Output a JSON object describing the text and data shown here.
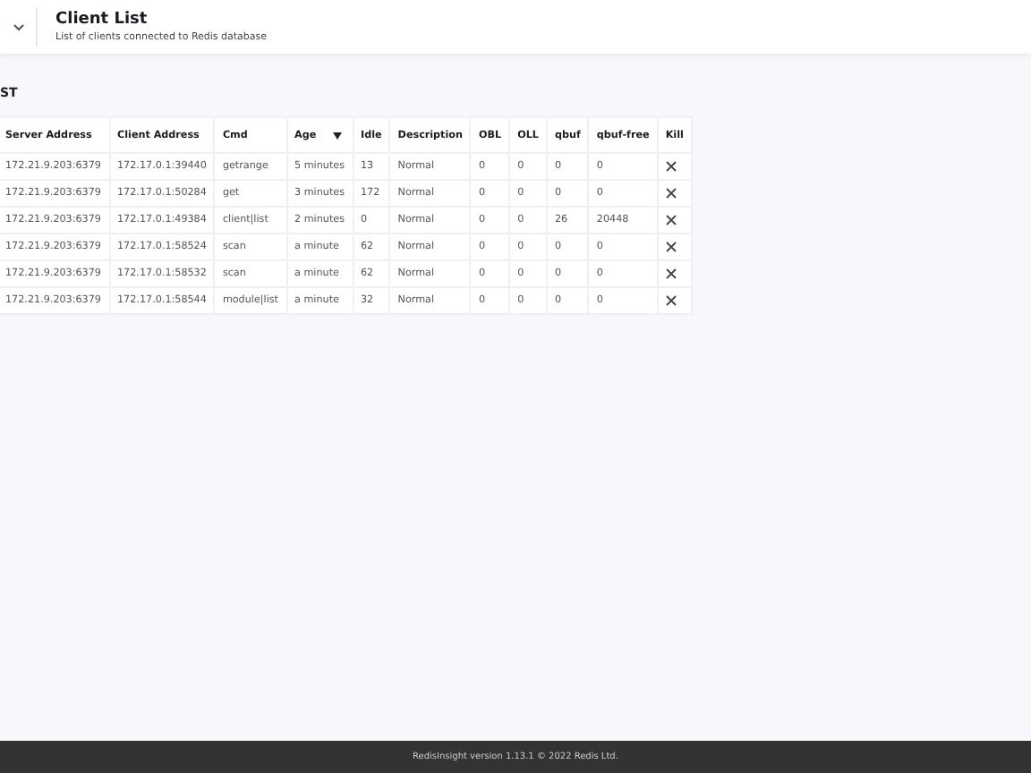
{
  "header": {
    "title": "Client List",
    "subtitle": "List of clients connected to Redis database"
  },
  "section_title": "ST",
  "table": {
    "columns": [
      {
        "label": "Server Address",
        "sorted": false
      },
      {
        "label": "Client Address",
        "sorted": false
      },
      {
        "label": "Cmd",
        "sorted": false
      },
      {
        "label": "Age",
        "sorted": true
      },
      {
        "label": "Idle",
        "sorted": false
      },
      {
        "label": "Description",
        "sorted": false
      },
      {
        "label": "OBL",
        "sorted": false
      },
      {
        "label": "OLL",
        "sorted": false
      },
      {
        "label": "qbuf",
        "sorted": false
      },
      {
        "label": "qbuf-free",
        "sorted": false
      },
      {
        "label": "Kill",
        "sorted": false
      }
    ],
    "rows": [
      [
        "172.21.9.203:6379",
        "172.17.0.1:39440",
        "getrange",
        "5 minutes",
        "13",
        "Normal",
        "0",
        "0",
        "0",
        "0"
      ],
      [
        "172.21.9.203:6379",
        "172.17.0.1:50284",
        "get",
        "3 minutes",
        "172",
        "Normal",
        "0",
        "0",
        "0",
        "0"
      ],
      [
        "172.21.9.203:6379",
        "172.17.0.1:49384",
        "client|list",
        "2 minutes",
        "0",
        "Normal",
        "0",
        "0",
        "26",
        "20448"
      ],
      [
        "172.21.9.203:6379",
        "172.17.0.1:58524",
        "scan",
        "a minute",
        "62",
        "Normal",
        "0",
        "0",
        "0",
        "0"
      ],
      [
        "172.21.9.203:6379",
        "172.17.0.1:58532",
        "scan",
        "a minute",
        "62",
        "Normal",
        "0",
        "0",
        "0",
        "0"
      ],
      [
        "172.21.9.203:6379",
        "172.17.0.1:58544",
        "module|list",
        "a minute",
        "32",
        "Normal",
        "0",
        "0",
        "0",
        "0"
      ]
    ]
  },
  "footer": "RedisInsight version 1.13.1 © 2022 Redis Ltd."
}
